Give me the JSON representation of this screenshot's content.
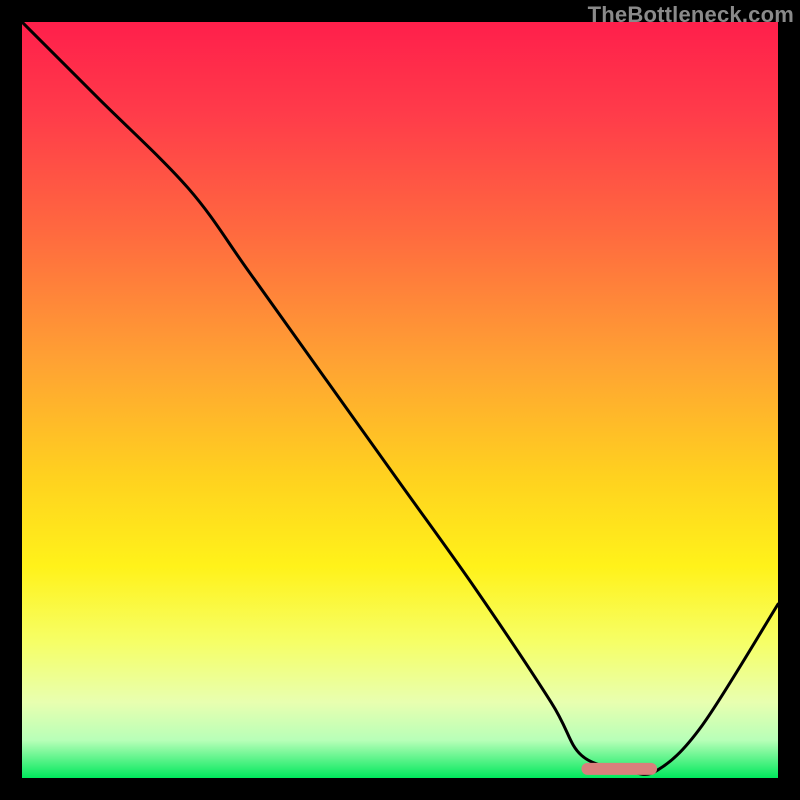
{
  "watermark": "TheBottleneck.com",
  "chart_data": {
    "type": "line",
    "title": "",
    "xlabel": "",
    "ylabel": "",
    "xlim": [
      0,
      100
    ],
    "ylim": [
      0,
      100
    ],
    "series": [
      {
        "name": "bottleneck-curve",
        "x": [
          0,
          10,
          22,
          30,
          40,
          50,
          60,
          70,
          74,
          80,
          84,
          90,
          100
        ],
        "values": [
          100,
          90,
          78,
          67,
          53,
          39,
          25,
          10,
          3,
          1,
          1,
          7,
          23
        ]
      }
    ],
    "optimal_marker": {
      "x_start": 74,
      "x_end": 84,
      "y": 1.2,
      "color": "#d9807c"
    },
    "gradient_stops": [
      {
        "offset": 0,
        "color": "#ff1f4b"
      },
      {
        "offset": 12,
        "color": "#ff3b4a"
      },
      {
        "offset": 28,
        "color": "#ff6a3f"
      },
      {
        "offset": 45,
        "color": "#ffa233"
      },
      {
        "offset": 60,
        "color": "#ffd11f"
      },
      {
        "offset": 72,
        "color": "#fff21a"
      },
      {
        "offset": 82,
        "color": "#f6ff66"
      },
      {
        "offset": 90,
        "color": "#e8ffb0"
      },
      {
        "offset": 95,
        "color": "#b8ffb8"
      },
      {
        "offset": 100,
        "color": "#00e85c"
      }
    ]
  }
}
